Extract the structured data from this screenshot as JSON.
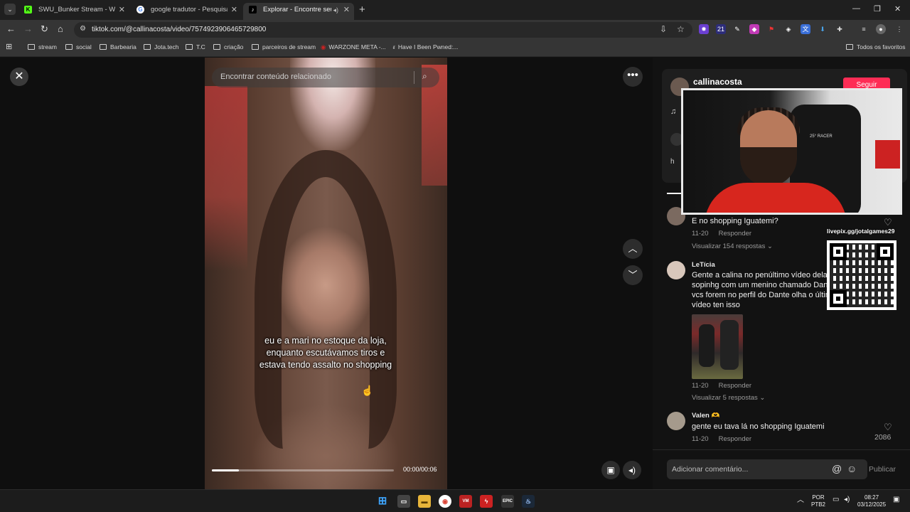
{
  "browser": {
    "tabs": [
      {
        "title": "SWU_Bunker Stream - Watch L",
        "favicon": "K",
        "color": "#53fc18"
      },
      {
        "title": "google tradutor - Pesquisa Goo",
        "favicon": "G",
        "color": "#ffffff"
      },
      {
        "title": "Explorar - Encontre seus víd",
        "favicon": "♪",
        "color": "#000000"
      }
    ],
    "url": "tiktok.com/@callinacosta/video/7574923906465729800",
    "bookmarks": [
      "stream",
      "social",
      "Barbearia",
      "Jota.tech",
      "T.C",
      "criação",
      "parceiros de stream",
      "WARZONE META -...",
      "Have I Been Pwned:..."
    ],
    "all_bookmarks": "Todos os favoritos"
  },
  "video": {
    "search_placeholder": "Encontrar conteúdo relacionado",
    "caption_lines": [
      "eu e a mari no estoque da loja,",
      "enquanto escutávamos tiros e",
      "estava tendo assalto no shopping"
    ],
    "time": "00:00/00:06",
    "progress": 0.15
  },
  "panel": {
    "creator": "callinacosta",
    "follow": "Seguir",
    "pill_h": "h",
    "comments": [
      {
        "user": "",
        "text": "E no shopping Iguatemi?",
        "date": "11-20",
        "reply": "Responder",
        "view_replies": "Visualizar 154 respostas"
      },
      {
        "user": "LeTícia",
        "text": "Gente a calina no penúltimo vídeo dela c/ta sopinhg com um menino chamado Dante e se vcs forem no perfil do Dante olha o último vídeo ten isso",
        "date": "11-20",
        "reply": "Responder",
        "view_replies": "Visualizar 5 respostas"
      },
      {
        "user": "Valen",
        "user_emoji": "🫶",
        "text": "gente eu tava lá no shopping Iguatemi",
        "date": "11-20",
        "reply": "Responder",
        "likes": "2086"
      }
    ],
    "add_comment_placeholder": "Adicionar comentário...",
    "publish": "Publicar"
  },
  "overlay": {
    "livepix": "livepix.gg/jotalgames29",
    "chair_text": "25° RACER"
  },
  "taskbar": {
    "lang_top": "POR",
    "lang_bottom": "PTB2",
    "time": "08:27",
    "date": "03/12/2025"
  }
}
